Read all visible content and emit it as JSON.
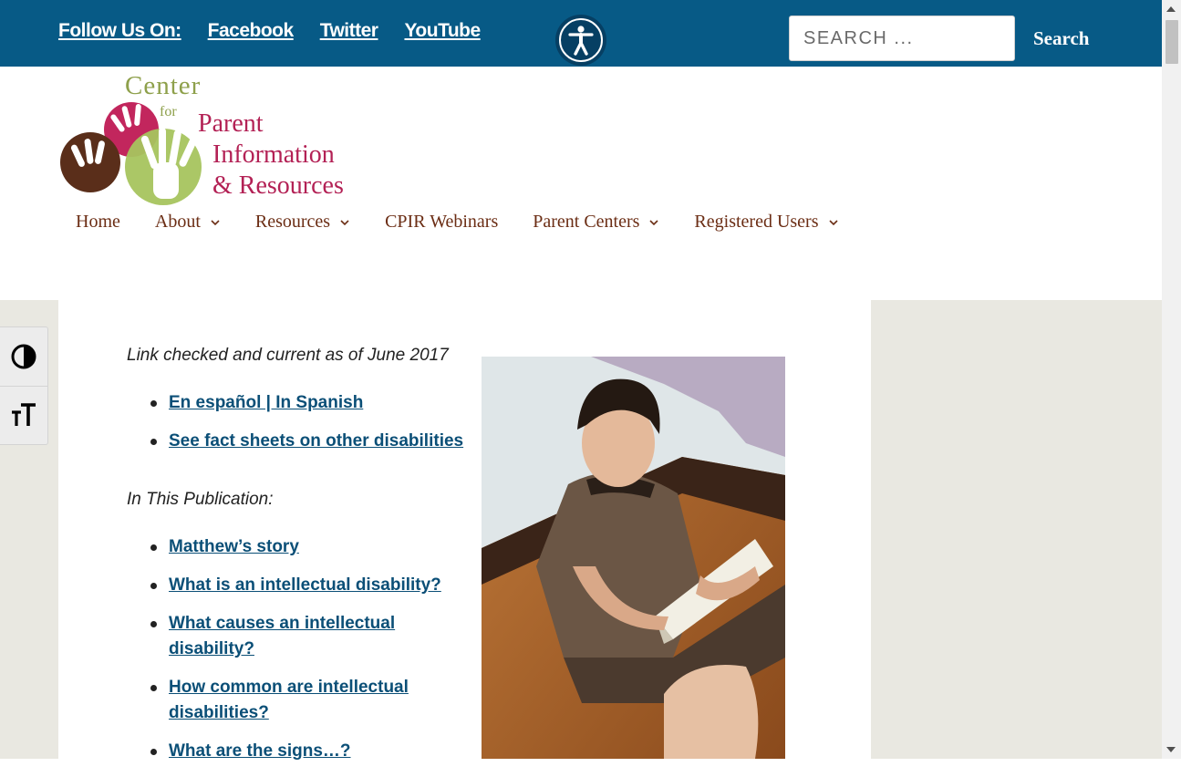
{
  "topbar": {
    "follow_label": "Follow Us On:",
    "social": [
      {
        "label": "Facebook"
      },
      {
        "label": "Twitter"
      },
      {
        "label": "YouTube"
      }
    ],
    "search_placeholder": "SEARCH ...",
    "search_button": "Search"
  },
  "logo": {
    "line1": "Center",
    "line2": "for",
    "line3": "Parent",
    "line4": "Information",
    "line5": "& Resources"
  },
  "nav": {
    "items": [
      {
        "label": "Home",
        "has_dropdown": false
      },
      {
        "label": "About",
        "has_dropdown": true
      },
      {
        "label": "Resources",
        "has_dropdown": true
      },
      {
        "label": "CPIR Webinars",
        "has_dropdown": false
      },
      {
        "label": "Parent Centers",
        "has_dropdown": true
      },
      {
        "label": "Registered Users",
        "has_dropdown": true
      }
    ]
  },
  "content": {
    "link_checked": "Link checked and current as of June 2017",
    "top_links": [
      {
        "label": "En español | In Spanish"
      },
      {
        "label": "See fact sheets on other disabilities"
      }
    ],
    "in_this_pub": "In This Publication:",
    "pub_links": [
      {
        "label": "Matthew’s story"
      },
      {
        "label": "What is an intellectual disability?"
      },
      {
        "label": "What causes an intellectual disability?"
      },
      {
        "label": "How common are intellectual disabilities?"
      },
      {
        "label": "What are the signs…?"
      }
    ]
  },
  "colors": {
    "topbar": "#075a86",
    "nav_text": "#6b2d14",
    "link": "#0b4f77",
    "page_bg": "#e9e8e1"
  },
  "icons": {
    "accessibility": "accessibility-person-icon",
    "contrast": "contrast-half-circle-icon",
    "font_size": "font-size-tT-icon",
    "dropdown": "chevron-down-icon"
  }
}
